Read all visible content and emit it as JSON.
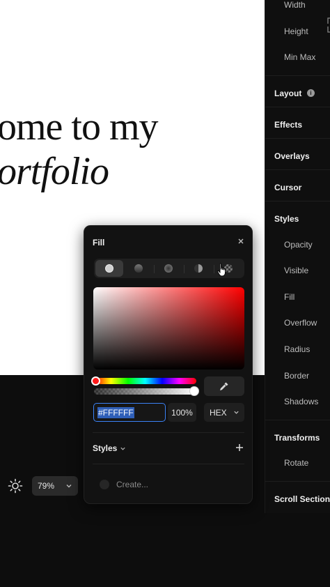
{
  "canvas": {
    "hero_line1": "ome to my",
    "hero_line2": "ortfolio"
  },
  "zoom": {
    "value": "79%"
  },
  "panel": {
    "width_label": "Width",
    "height_label": "Height",
    "minmax_label": "Min Max",
    "layout": "Layout",
    "effects": "Effects",
    "overlays": "Overlays",
    "cursor": "Cursor",
    "styles": "Styles",
    "opacity": "Opacity",
    "visible": "Visible",
    "fill": "Fill",
    "overflow": "Overflow",
    "radius": "Radius",
    "border": "Border",
    "shadows": "Shadows",
    "transforms": "Transforms",
    "rotate": "Rotate",
    "scroll_section": "Scroll Section"
  },
  "fill_popover": {
    "title": "Fill",
    "hex_value": "#FFFFFF",
    "opacity_value": "100%",
    "format": "HEX",
    "styles_label": "Styles",
    "create_label": "Create..."
  },
  "colors": {
    "accent": "#3b82f6",
    "hue": "#ff0000"
  }
}
